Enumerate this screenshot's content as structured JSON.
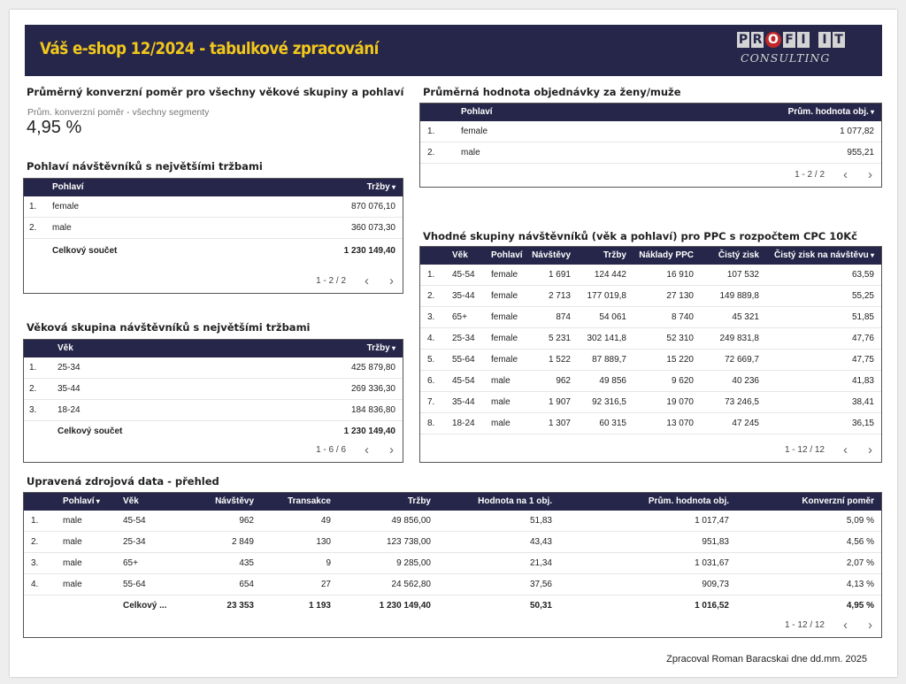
{
  "header": {
    "title": "Váš e-shop 12/2024 - tabulkové zpracování",
    "logo_letters": [
      "P",
      "R",
      "O",
      "F",
      "I",
      "I",
      "T"
    ],
    "logo_sub": "CONSULTING"
  },
  "kpi": {
    "title": "Průměrný konverzní poměr pro všechny věkové skupiny a pohlaví",
    "label": "Prům. konverzní poměr - všechny segmenty",
    "value": "4,95 %"
  },
  "gender_revenue": {
    "title": "Pohlaví návštěvníků s největšími tržbami",
    "columns": [
      "Pohlaví",
      "Tržby"
    ],
    "rows": [
      {
        "n": "1.",
        "pohlavi": "female",
        "trzby": "870 076,10"
      },
      {
        "n": "2.",
        "pohlavi": "male",
        "trzby": "360 073,30"
      }
    ],
    "total_label": "Celkový součet",
    "total_value": "1 230 149,40",
    "pager": "1 - 2 / 2"
  },
  "age_revenue": {
    "title": "Věková skupina návštěvníků s největšími tržbami",
    "columns": [
      "Věk",
      "Tržby"
    ],
    "rows": [
      {
        "n": "1.",
        "vek": "25-34",
        "trzby": "425 879,80"
      },
      {
        "n": "2.",
        "vek": "35-44",
        "trzby": "269 336,30"
      },
      {
        "n": "3.",
        "vek": "18-24",
        "trzby": "184 836,80"
      }
    ],
    "total_label": "Celkový součet",
    "total_value": "1 230 149,40",
    "pager": "1 - 6 / 6"
  },
  "order_value": {
    "title": "Průměrná hodnota objednávky za ženy/muže",
    "columns": [
      "Pohlaví",
      "Prům. hodnota obj."
    ],
    "rows": [
      {
        "n": "1.",
        "pohlavi": "female",
        "hodnota": "1 077,82"
      },
      {
        "n": "2.",
        "pohlavi": "male",
        "hodnota": "955,21"
      }
    ],
    "pager": "1 - 2 / 2"
  },
  "ppc": {
    "title": "Vhodné skupiny návštěvníků (věk a pohlaví) pro PPC s rozpočtem CPC 10Kč",
    "columns": [
      "Věk",
      "Pohlaví",
      "Návštěvy",
      "Tržby",
      "Náklady PPC",
      "Čistý zisk",
      "Čistý zisk na návštěvu"
    ],
    "rows": [
      {
        "n": "1.",
        "vek": "45-54",
        "pohlavi": "female",
        "navstevy": "1 691",
        "trzby": "124 442",
        "naklady": "16 910",
        "zisk": "107 532",
        "zisk_nav": "63,59"
      },
      {
        "n": "2.",
        "vek": "35-44",
        "pohlavi": "female",
        "navstevy": "2 713",
        "trzby": "177 019,8",
        "naklady": "27 130",
        "zisk": "149 889,8",
        "zisk_nav": "55,25"
      },
      {
        "n": "3.",
        "vek": "65+",
        "pohlavi": "female",
        "navstevy": "874",
        "trzby": "54 061",
        "naklady": "8 740",
        "zisk": "45 321",
        "zisk_nav": "51,85"
      },
      {
        "n": "4.",
        "vek": "25-34",
        "pohlavi": "female",
        "navstevy": "5 231",
        "trzby": "302 141,8",
        "naklady": "52 310",
        "zisk": "249 831,8",
        "zisk_nav": "47,76"
      },
      {
        "n": "5.",
        "vek": "55-64",
        "pohlavi": "female",
        "navstevy": "1 522",
        "trzby": "87 889,7",
        "naklady": "15 220",
        "zisk": "72 669,7",
        "zisk_nav": "47,75"
      },
      {
        "n": "6.",
        "vek": "45-54",
        "pohlavi": "male",
        "navstevy": "962",
        "trzby": "49 856",
        "naklady": "9 620",
        "zisk": "40 236",
        "zisk_nav": "41,83"
      },
      {
        "n": "7.",
        "vek": "35-44",
        "pohlavi": "male",
        "navstevy": "1 907",
        "trzby": "92 316,5",
        "naklady": "19 070",
        "zisk": "73 246,5",
        "zisk_nav": "38,41"
      },
      {
        "n": "8.",
        "vek": "18-24",
        "pohlavi": "male",
        "navstevy": "1 307",
        "trzby": "60 315",
        "naklady": "13 070",
        "zisk": "47 245",
        "zisk_nav": "36,15"
      }
    ],
    "pager": "1 - 12 / 12"
  },
  "source": {
    "title": "Upravená zdrojová data - přehled",
    "columns": [
      "Pohlaví",
      "Věk",
      "Návštěvy",
      "Transakce",
      "Tržby",
      "Hodnota na 1 obj.",
      "Prům. hodnota obj.",
      "Konverzní poměr"
    ],
    "rows": [
      {
        "n": "1.",
        "pohlavi": "male",
        "vek": "45-54",
        "navstevy": "962",
        "transakce": "49",
        "trzby": "49 856,00",
        "hodnota1": "51,83",
        "prum": "1 017,47",
        "konv": "5,09 %"
      },
      {
        "n": "2.",
        "pohlavi": "male",
        "vek": "25-34",
        "navstevy": "2 849",
        "transakce": "130",
        "trzby": "123 738,00",
        "hodnota1": "43,43",
        "prum": "951,83",
        "konv": "4,56 %"
      },
      {
        "n": "3.",
        "pohlavi": "male",
        "vek": "65+",
        "navstevy": "435",
        "transakce": "9",
        "trzby": "9 285,00",
        "hodnota1": "21,34",
        "prum": "1 031,67",
        "konv": "2,07 %"
      },
      {
        "n": "4.",
        "pohlavi": "male",
        "vek": "55-64",
        "navstevy": "654",
        "transakce": "27",
        "trzby": "24 562,80",
        "hodnota1": "37,56",
        "prum": "909,73",
        "konv": "4,13 %"
      }
    ],
    "total": {
      "label": "Celkový ...",
      "navstevy": "23 353",
      "transakce": "1 193",
      "trzby": "1 230 149,40",
      "hodnota1": "50,31",
      "prum": "1 016,52",
      "konv": "4,95 %"
    },
    "pager": "1 - 12 / 12"
  },
  "pager_icons": {
    "prev": "‹",
    "next": "›"
  },
  "footer": {
    "note": "Zpracoval Roman Baracskai dne dd.mm. 2025"
  }
}
